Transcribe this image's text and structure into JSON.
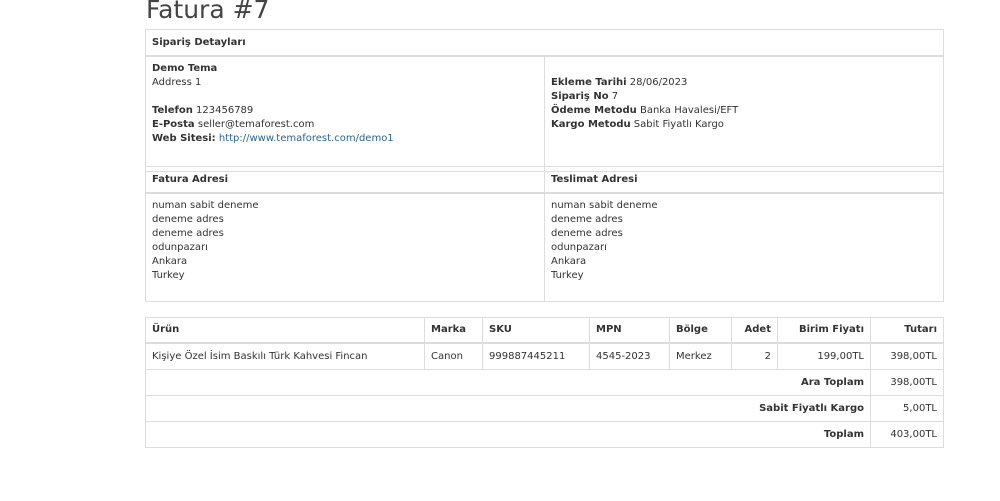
{
  "page_title": "Fatura #7",
  "order_details": {
    "header": "Sipariş Detayları",
    "store": {
      "name": "Demo Tema",
      "address": "Address 1",
      "phone_label": "Telefon",
      "phone": "123456789",
      "email_label": "E-Posta",
      "email": "seller@temaforest.com",
      "website_label": "Web Sitesi:",
      "website": "http://www.temaforest.com/demo1"
    },
    "info": {
      "date_label": "Ekleme Tarihi",
      "date": "28/06/2023",
      "order_no_label": "Sipariş No",
      "order_no": "7",
      "payment_label": "Ödeme Metodu",
      "payment": "Banka Havalesi/EFT",
      "shipping_label": "Kargo Metodu",
      "shipping": "Sabit Fiyatlı Kargo"
    }
  },
  "addresses": {
    "billing_header": "Fatura Adresi",
    "shipping_header": "Teslimat Adresi",
    "billing_lines": [
      "numan sabit deneme",
      "deneme adres",
      "deneme adres",
      "odunpazarı",
      "Ankara",
      "Turkey"
    ],
    "shipping_lines": [
      "numan sabit deneme",
      "deneme adres",
      "deneme adres",
      "odunpazarı",
      "Ankara",
      "Turkey"
    ]
  },
  "products": {
    "headers": {
      "product": "Ürün",
      "brand": "Marka",
      "sku": "SKU",
      "mpn": "MPN",
      "region": "Bölge",
      "qty": "Adet",
      "unit_price": "Birim Fiyatı",
      "total": "Tutarı"
    },
    "rows": [
      {
        "product": "Kişiye Özel İsim Baskılı Türk Kahvesi Fincan",
        "brand": "Canon",
        "sku": "999887445211",
        "mpn": "4545-2023",
        "region": "Merkez",
        "qty": "2",
        "unit_price": "199,00TL",
        "total": "398,00TL"
      }
    ],
    "totals": [
      {
        "label": "Ara Toplam",
        "value": "398,00TL"
      },
      {
        "label": "Sabit Fiyatlı Kargo",
        "value": "5,00TL"
      },
      {
        "label": "Toplam",
        "value": "403,00TL"
      }
    ]
  }
}
